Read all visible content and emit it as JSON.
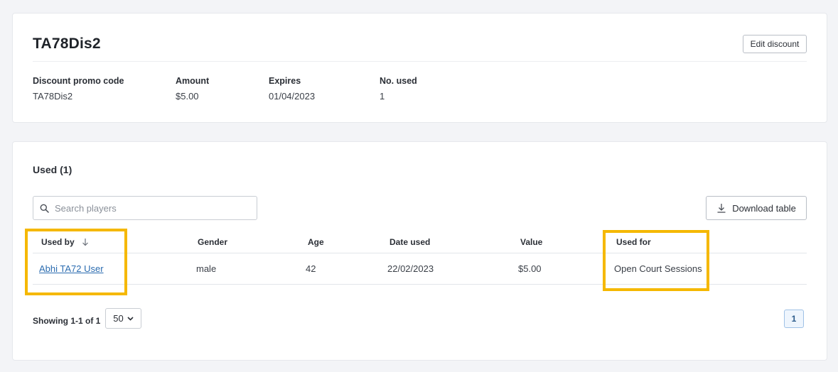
{
  "discount": {
    "title": "TA78Dis2",
    "edit_label": "Edit discount",
    "fields": [
      {
        "label": "Discount promo code",
        "value": "TA78Dis2"
      },
      {
        "label": "Amount",
        "value": "$5.00"
      },
      {
        "label": "Expires",
        "value": "01/04/2023"
      },
      {
        "label": "No. used",
        "value": "1"
      }
    ]
  },
  "used": {
    "title": "Used (1)",
    "search_placeholder": "Search players",
    "download_label": "Download table",
    "columns": [
      "Used by",
      "Gender",
      "Age",
      "Date used",
      "Value",
      "Used for"
    ],
    "rows": [
      {
        "used_by": "Abhi TA72 User",
        "gender": "male",
        "age": "42",
        "date_used": "22/02/2023",
        "value": "$5.00",
        "used_for": "Open Court Sessions"
      }
    ],
    "showing": "Showing 1-1 of 1",
    "page_size": "50",
    "current_page": "1"
  },
  "colors": {
    "highlight": "#f5b800",
    "link": "#2b6cb0"
  }
}
